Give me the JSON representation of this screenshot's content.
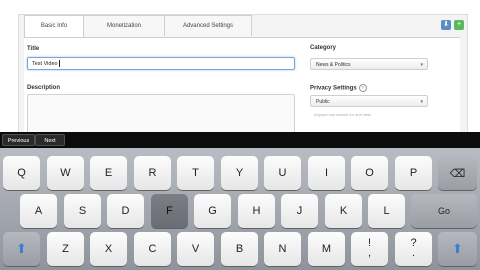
{
  "tabs": [
    "Basic Info",
    "Monetization",
    "Advanced Settings"
  ],
  "form": {
    "title_label": "Title",
    "title_value": "Test Video",
    "description_label": "Description",
    "category_label": "Category",
    "category_value": "News & Politics",
    "privacy_label": "Privacy Settings",
    "privacy_value": "Public",
    "privacy_hint": "Anyone can search for and view",
    "help_icon": "?"
  },
  "accessory": {
    "previous_label": "Previous",
    "next_label": "Next"
  },
  "keyboard": {
    "row1": [
      "Q",
      "W",
      "E",
      "R",
      "T",
      "Y",
      "U",
      "I",
      "O",
      "P"
    ],
    "row2": [
      "A",
      "S",
      "D",
      "F",
      "G",
      "H",
      "J",
      "K",
      "L"
    ],
    "go_label": "Go",
    "row3": [
      "Z",
      "X",
      "C",
      "V",
      "B",
      "N",
      "M",
      "!",
      ",",
      "?",
      "."
    ],
    "pressed_key": "F"
  },
  "icons": {
    "backspace": "⌫",
    "shift": "⬆"
  }
}
